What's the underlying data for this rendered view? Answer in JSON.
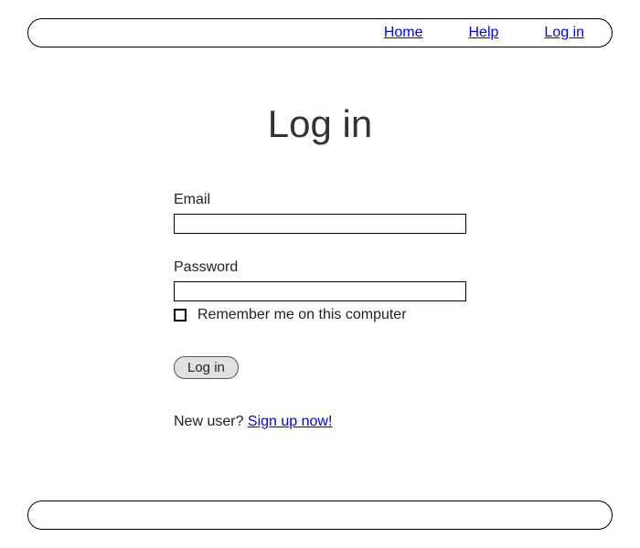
{
  "header": {
    "nav": {
      "home": "Home",
      "help": "Help",
      "login": "Log in"
    }
  },
  "main": {
    "title": "Log in",
    "email_label": "Email",
    "email_value": "",
    "password_label": "Password",
    "password_value": "",
    "remember_label": "Remember me on this computer",
    "remember_checked": false,
    "submit_label": "Log in",
    "signup_prompt": "New user? ",
    "signup_link": "Sign up now!"
  }
}
